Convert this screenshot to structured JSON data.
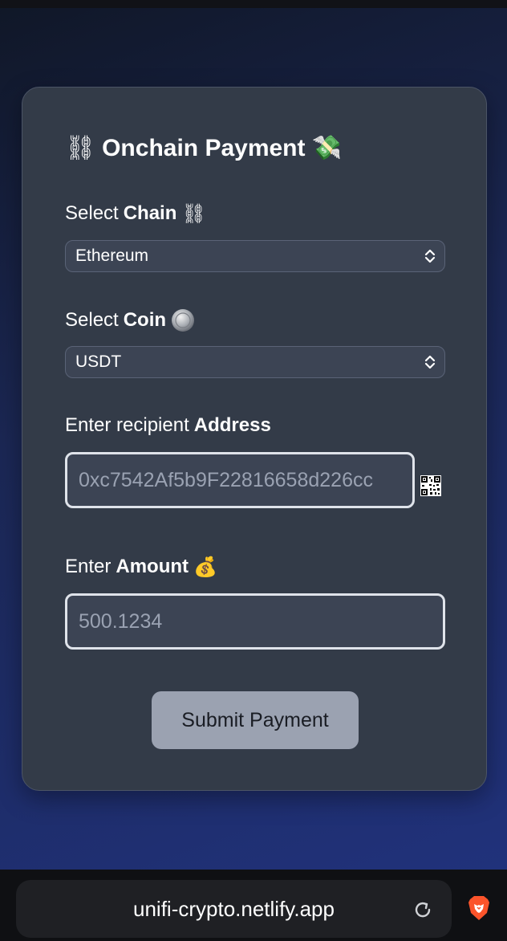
{
  "card": {
    "title": "Onchain Payment",
    "title_icon_left": "chain-icon",
    "title_icon_right": "money-with-wings-icon"
  },
  "chain": {
    "label_prefix": "Select",
    "label_bold": "Chain",
    "label_icon": "chain-icon",
    "selected": "Ethereum"
  },
  "coin": {
    "label_prefix": "Select",
    "label_bold": "Coin",
    "label_icon": "coin-icon",
    "selected": "USDT"
  },
  "address": {
    "label_prefix": "Enter recipient",
    "label_bold": "Address",
    "placeholder": "0xc7542Af5b9F22816658d226cc",
    "qr_icon": "qr-code-icon"
  },
  "amount": {
    "label_prefix": "Enter",
    "label_bold": "Amount",
    "label_icon": "money-bag-icon",
    "placeholder": "500.1234"
  },
  "submit_label": "Submit Payment",
  "browser": {
    "url": "unifi-crypto.netlify.app",
    "reload_icon": "reload-icon",
    "brand_icon": "brave-lion-icon"
  },
  "colors": {
    "card_bg": "#333b48",
    "button_bg": "#9ba2b1",
    "page_gradient_end": "#213380"
  }
}
